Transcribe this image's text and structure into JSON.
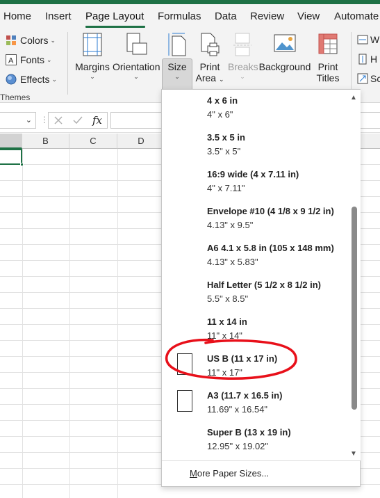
{
  "ribbon": {
    "tabs": [
      "Home",
      "Insert",
      "Page Layout",
      "Formulas",
      "Data",
      "Review",
      "View",
      "Automate"
    ],
    "active_tab": "Page Layout",
    "themes": {
      "colors": "Colors",
      "fonts": "Fonts",
      "effects": "Effects",
      "group_label": "Themes"
    },
    "buttons": {
      "margins": "Margins",
      "orientation": "Orientation",
      "size": "Size",
      "print_area_1": "Print",
      "print_area_2": "Area",
      "breaks": "Breaks",
      "background": "Background",
      "print_titles_1": "Print",
      "print_titles_2": "Titles"
    },
    "right_items": [
      "W",
      "H",
      "Sc"
    ]
  },
  "formula_bar": {
    "fx": "fx"
  },
  "grid": {
    "columns": [
      "B",
      "C",
      "D"
    ]
  },
  "size_menu": {
    "items": [
      {
        "title": "4 x 6 in",
        "dims": "4\" x 6\""
      },
      {
        "title": "3.5 x 5 in",
        "dims": "3.5\" x 5\""
      },
      {
        "title": "16:9 wide (4 x 7.11 in)",
        "dims": "4\" x 7.11\""
      },
      {
        "title": "Envelope #10 (4 1/8 x 9 1/2 in)",
        "dims": "4.13\" x 9.5\""
      },
      {
        "title": "A6 4.1 x 5.8 in (105 x 148 mm)",
        "dims": "4.13\" x 5.83\""
      },
      {
        "title": "Half Letter (5 1/2 x 8 1/2 in)",
        "dims": "5.5\" x 8.5\""
      },
      {
        "title": "11 x 14 in",
        "dims": "11\" x 14\""
      },
      {
        "title": "US B (11 x 17 in)",
        "dims": "11\" x 17\""
      },
      {
        "title": "A3 (11.7 x 16.5 in)",
        "dims": "11.69\" x 16.54\""
      },
      {
        "title": "Super B (13 x 19 in)",
        "dims": "12.95\" x 19.02\""
      }
    ],
    "more_underlined": "M",
    "more_rest": "ore Paper Sizes...",
    "highlighted_item": "US B (11 x 17 in)",
    "annotation_color": "#e8101a"
  },
  "colors": {
    "accent": "#1e7145"
  }
}
